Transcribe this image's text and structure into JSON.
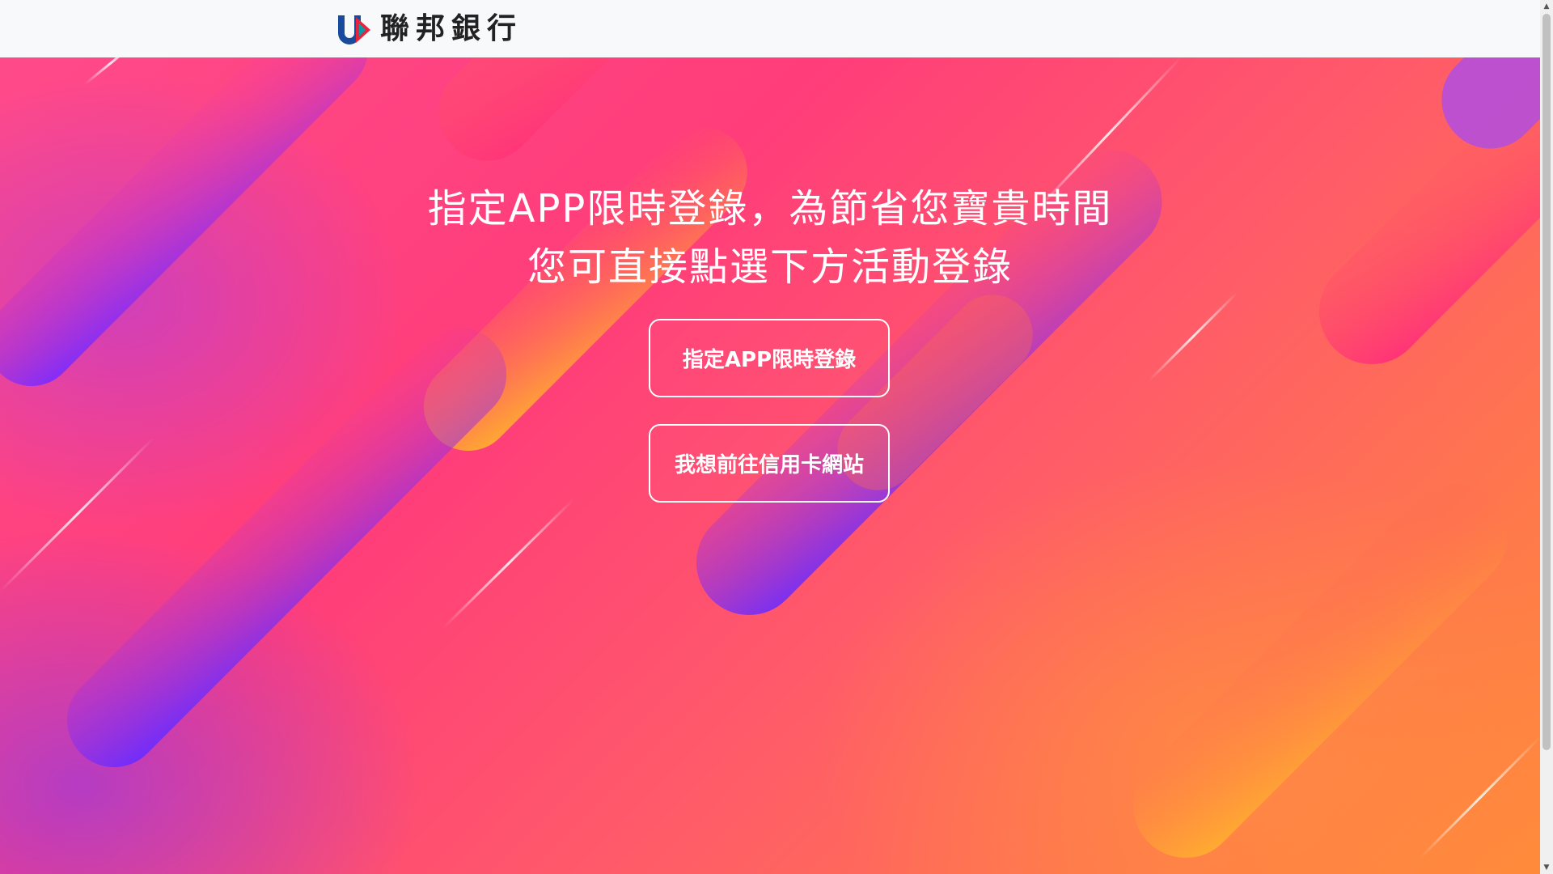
{
  "header": {
    "logo_text": "聯邦銀行",
    "logo_mark_letters": "UB"
  },
  "hero": {
    "headline_line1": "指定APP限時登錄，為節省您寶貴時間",
    "headline_line2": "您可直接點選下方活動登錄",
    "buttons": [
      {
        "label": "指定APP限時登錄"
      },
      {
        "label": "我想前往信用卡網站"
      }
    ]
  },
  "scrollbar": {
    "up_icon": "scroll-up-arrow-icon",
    "down_icon": "scroll-down-arrow-icon"
  },
  "colors": {
    "brand_blue": "#1a4a9c",
    "brand_red": "#e8243c",
    "hero_pink": "#ff3d7a",
    "hero_orange": "#ff8a3a",
    "hero_purple": "#8a3cff",
    "button_border": "#ffffff"
  }
}
